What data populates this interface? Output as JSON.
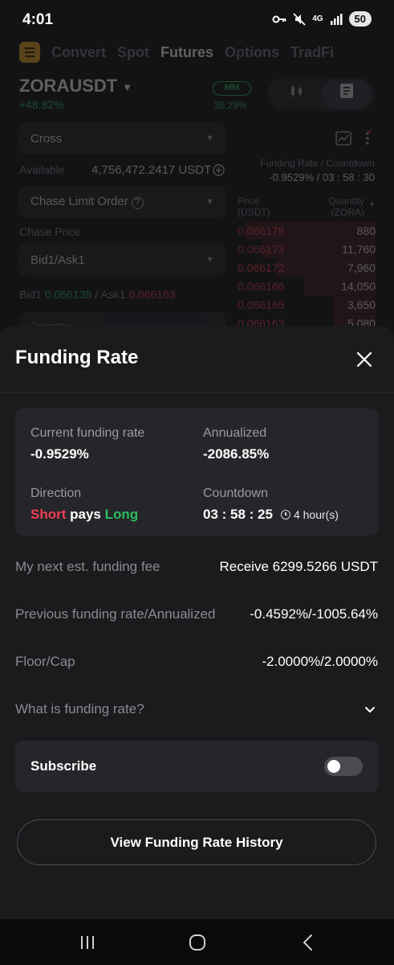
{
  "status_bar": {
    "time": "4:01",
    "network": "4G",
    "battery": "50",
    "icons": [
      "key-icon",
      "mute-icon",
      "signal-icon"
    ]
  },
  "background": {
    "nav_tabs": [
      "Convert",
      "Spot",
      "Futures",
      "Options",
      "TradFi"
    ],
    "active_tab": "Futures",
    "pair": "ZORAUSDT",
    "change": "+48.82%",
    "mm_label": "MM",
    "mm_value": "36.29%",
    "margin_mode": "Cross",
    "available_label": "Available",
    "available_value": "4,756,472.2417 USDT",
    "order_type": "Chase Limit Order",
    "chase_price_label": "Chase Price",
    "chase_price_value": "Bid1/Ask1",
    "bid_label": "Bid1",
    "bid_value": "0.066138",
    "ask_label": "Ask1",
    "ask_value": "0.066163",
    "quantity_placeholder": "Quantity",
    "funding_header": "Funding Rate / Countdown",
    "funding_value": "-0.9529% / 03 : 58 : 30",
    "orderbook": {
      "price_header": "Price",
      "price_unit": "(USDT)",
      "qty_header": "Quantity",
      "qty_unit": "(ZORA)",
      "asks": [
        {
          "price": "0.066178",
          "qty": "880",
          "depth": 0.95
        },
        {
          "price": "0.066173",
          "qty": "11,760",
          "depth": 0.82
        },
        {
          "price": "0.066172",
          "qty": "7,960",
          "depth": 0.72
        },
        {
          "price": "0.066166",
          "qty": "14,050",
          "depth": 0.52
        },
        {
          "price": "0.066165",
          "qty": "3,650",
          "depth": 0.3
        },
        {
          "price": "0.066163",
          "qty": "5,080",
          "depth": 0.3
        }
      ]
    }
  },
  "sheet": {
    "title": "Funding Rate",
    "card": {
      "current_label": "Current funding rate",
      "current_value": "-0.9529%",
      "annualized_label": "Annualized",
      "annualized_value": "-2086.85%",
      "direction_label": "Direction",
      "direction_short": "Short",
      "direction_pays": "pays",
      "direction_long": "Long",
      "countdown_label": "Countdown",
      "countdown_value": "03 : 58 : 25",
      "interval": "4 hour(s)"
    },
    "rows": [
      {
        "label": "My next est. funding fee",
        "value": "Receive 6299.5266 USDT"
      },
      {
        "label": "Previous funding rate/Annualized",
        "value": "-0.4592%/-1005.64%"
      },
      {
        "label": "Floor/Cap",
        "value": "-2.0000%/2.0000%"
      }
    ],
    "faq_label": "What is funding rate?",
    "subscribe_label": "Subscribe",
    "subscribe_on": false,
    "history_button": "View Funding Rate History"
  },
  "colors": {
    "short_red": "#ef3e50",
    "long_green": "#2ebd60",
    "accent": "#f0a623"
  }
}
